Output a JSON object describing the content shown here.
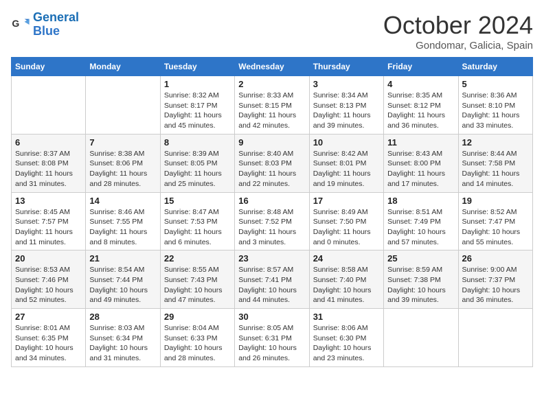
{
  "logo": {
    "line1": "General",
    "line2": "Blue"
  },
  "title": "October 2024",
  "subtitle": "Gondomar, Galicia, Spain",
  "days_of_week": [
    "Sunday",
    "Monday",
    "Tuesday",
    "Wednesday",
    "Thursday",
    "Friday",
    "Saturday"
  ],
  "weeks": [
    [
      {
        "day": "",
        "info": ""
      },
      {
        "day": "",
        "info": ""
      },
      {
        "day": "1",
        "info": "Sunrise: 8:32 AM\nSunset: 8:17 PM\nDaylight: 11 hours and 45 minutes."
      },
      {
        "day": "2",
        "info": "Sunrise: 8:33 AM\nSunset: 8:15 PM\nDaylight: 11 hours and 42 minutes."
      },
      {
        "day": "3",
        "info": "Sunrise: 8:34 AM\nSunset: 8:13 PM\nDaylight: 11 hours and 39 minutes."
      },
      {
        "day": "4",
        "info": "Sunrise: 8:35 AM\nSunset: 8:12 PM\nDaylight: 11 hours and 36 minutes."
      },
      {
        "day": "5",
        "info": "Sunrise: 8:36 AM\nSunset: 8:10 PM\nDaylight: 11 hours and 33 minutes."
      }
    ],
    [
      {
        "day": "6",
        "info": "Sunrise: 8:37 AM\nSunset: 8:08 PM\nDaylight: 11 hours and 31 minutes."
      },
      {
        "day": "7",
        "info": "Sunrise: 8:38 AM\nSunset: 8:06 PM\nDaylight: 11 hours and 28 minutes."
      },
      {
        "day": "8",
        "info": "Sunrise: 8:39 AM\nSunset: 8:05 PM\nDaylight: 11 hours and 25 minutes."
      },
      {
        "day": "9",
        "info": "Sunrise: 8:40 AM\nSunset: 8:03 PM\nDaylight: 11 hours and 22 minutes."
      },
      {
        "day": "10",
        "info": "Sunrise: 8:42 AM\nSunset: 8:01 PM\nDaylight: 11 hours and 19 minutes."
      },
      {
        "day": "11",
        "info": "Sunrise: 8:43 AM\nSunset: 8:00 PM\nDaylight: 11 hours and 17 minutes."
      },
      {
        "day": "12",
        "info": "Sunrise: 8:44 AM\nSunset: 7:58 PM\nDaylight: 11 hours and 14 minutes."
      }
    ],
    [
      {
        "day": "13",
        "info": "Sunrise: 8:45 AM\nSunset: 7:57 PM\nDaylight: 11 hours and 11 minutes."
      },
      {
        "day": "14",
        "info": "Sunrise: 8:46 AM\nSunset: 7:55 PM\nDaylight: 11 hours and 8 minutes."
      },
      {
        "day": "15",
        "info": "Sunrise: 8:47 AM\nSunset: 7:53 PM\nDaylight: 11 hours and 6 minutes."
      },
      {
        "day": "16",
        "info": "Sunrise: 8:48 AM\nSunset: 7:52 PM\nDaylight: 11 hours and 3 minutes."
      },
      {
        "day": "17",
        "info": "Sunrise: 8:49 AM\nSunset: 7:50 PM\nDaylight: 11 hours and 0 minutes."
      },
      {
        "day": "18",
        "info": "Sunrise: 8:51 AM\nSunset: 7:49 PM\nDaylight: 10 hours and 57 minutes."
      },
      {
        "day": "19",
        "info": "Sunrise: 8:52 AM\nSunset: 7:47 PM\nDaylight: 10 hours and 55 minutes."
      }
    ],
    [
      {
        "day": "20",
        "info": "Sunrise: 8:53 AM\nSunset: 7:46 PM\nDaylight: 10 hours and 52 minutes."
      },
      {
        "day": "21",
        "info": "Sunrise: 8:54 AM\nSunset: 7:44 PM\nDaylight: 10 hours and 49 minutes."
      },
      {
        "day": "22",
        "info": "Sunrise: 8:55 AM\nSunset: 7:43 PM\nDaylight: 10 hours and 47 minutes."
      },
      {
        "day": "23",
        "info": "Sunrise: 8:57 AM\nSunset: 7:41 PM\nDaylight: 10 hours and 44 minutes."
      },
      {
        "day": "24",
        "info": "Sunrise: 8:58 AM\nSunset: 7:40 PM\nDaylight: 10 hours and 41 minutes."
      },
      {
        "day": "25",
        "info": "Sunrise: 8:59 AM\nSunset: 7:38 PM\nDaylight: 10 hours and 39 minutes."
      },
      {
        "day": "26",
        "info": "Sunrise: 9:00 AM\nSunset: 7:37 PM\nDaylight: 10 hours and 36 minutes."
      }
    ],
    [
      {
        "day": "27",
        "info": "Sunrise: 8:01 AM\nSunset: 6:35 PM\nDaylight: 10 hours and 34 minutes."
      },
      {
        "day": "28",
        "info": "Sunrise: 8:03 AM\nSunset: 6:34 PM\nDaylight: 10 hours and 31 minutes."
      },
      {
        "day": "29",
        "info": "Sunrise: 8:04 AM\nSunset: 6:33 PM\nDaylight: 10 hours and 28 minutes."
      },
      {
        "day": "30",
        "info": "Sunrise: 8:05 AM\nSunset: 6:31 PM\nDaylight: 10 hours and 26 minutes."
      },
      {
        "day": "31",
        "info": "Sunrise: 8:06 AM\nSunset: 6:30 PM\nDaylight: 10 hours and 23 minutes."
      },
      {
        "day": "",
        "info": ""
      },
      {
        "day": "",
        "info": ""
      }
    ]
  ]
}
